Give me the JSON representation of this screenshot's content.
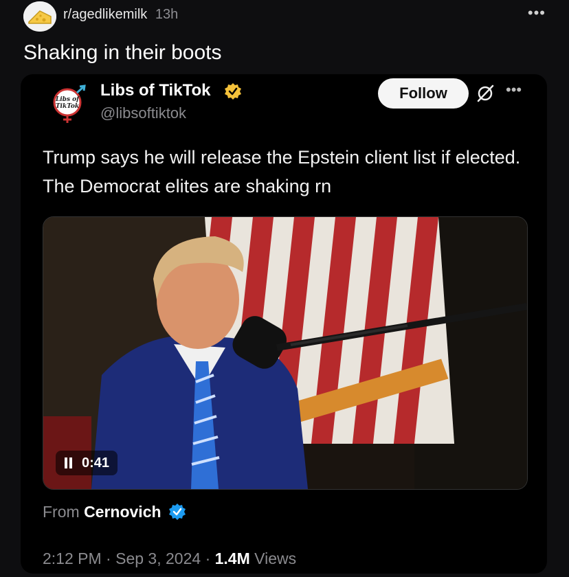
{
  "header": {
    "subreddit": "r/agedlikemilk",
    "time": "13h",
    "title": "Shaking in their boots",
    "more": "•••"
  },
  "tweet": {
    "author": "Libs of TikTok",
    "handle": "@libsoftiktok",
    "follow_label": "Follow",
    "more": "•••",
    "logo_text": [
      "Libs of",
      "TikTok"
    ],
    "text": "Trump says he will release the Epstein client list if elected. The Democrat elites are shaking rn",
    "video": {
      "time": "0:41"
    },
    "from_prefix": "From",
    "from_name": "Cernovich",
    "time": "2:12 PM",
    "date": "Sep 3, 2024",
    "views_count": "1.4M",
    "views_label": "Views"
  },
  "colors": {
    "background": "#0e0e10",
    "tweet_bg": "#000000",
    "muted": "#8b8b8f",
    "verified_gold": "#f4c13a",
    "verified_blue": "#1d9bf0"
  },
  "icons": [
    "cheese-avatar-icon",
    "more-icon",
    "verified-gold-icon",
    "grok-icon",
    "pause-icon",
    "verified-blue-icon"
  ]
}
